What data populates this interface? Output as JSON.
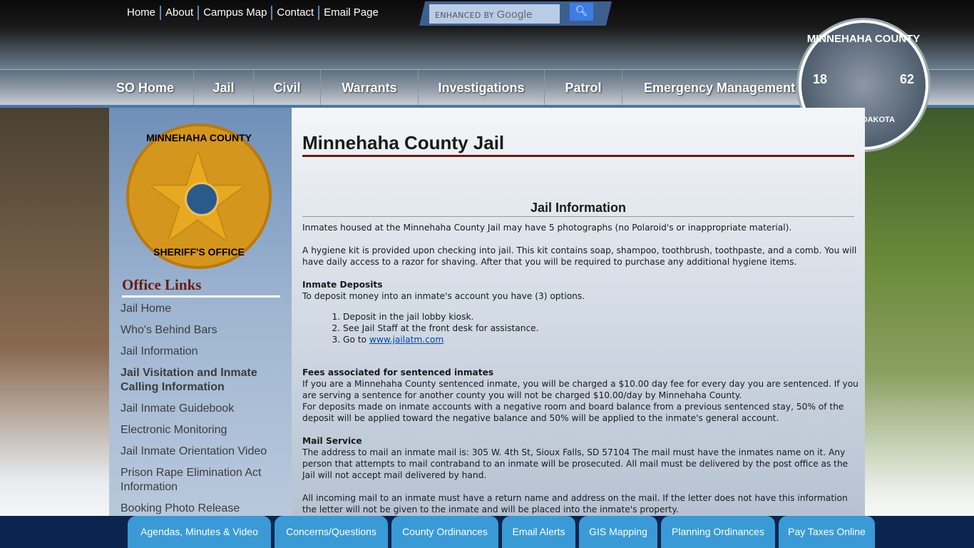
{
  "utility_nav": [
    "Home",
    "About",
    "Campus Map",
    "Contact",
    "Email Page"
  ],
  "search": {
    "placeholder_prefix": "ENHANCED BY",
    "placeholder_brand": "Google",
    "button_icon": "search-icon"
  },
  "main_nav": [
    "SO Home",
    "Jail",
    "Civil",
    "Warrants",
    "Investigations",
    "Patrol",
    "Emergency Management"
  ],
  "county_seal": {
    "top": "MINNEHAHA COUNTY",
    "year_left": "18",
    "year_right": "62",
    "bottom": "SOUTH DAKOTA"
  },
  "sheriff_badge": {
    "top": "MINNEHAHA COUNTY",
    "bottom": "SHERIFF'S OFFICE"
  },
  "sidebar": {
    "heading": "Office Links",
    "links": [
      "Jail Home",
      "Who's Behind Bars",
      "Jail Information",
      "Jail Visitation and Inmate Calling Information",
      "Jail Inmate Guidebook",
      "Electronic Monitoring",
      "Jail Inmate Orientation Video",
      "Prison Rape Elimination Act Information",
      "Booking Photo Release"
    ]
  },
  "page": {
    "title": "Minnehaha County Jail",
    "section_title": "Jail Information",
    "p1": "Inmates housed at the Minnehaha County Jail may have 5 photographs (no Polaroid's or inappropriate material).",
    "p2": "A hygiene kit is provided upon checking into jail. This kit contains soap, shampoo, toothbrush, toothpaste, and a comb. You will have daily access to a razor for shaving. After that you will be required to purchase any additional hygiene items.",
    "deposits_heading": "Inmate Deposits",
    "deposits_intro": "To deposit money into an inmate's account you have (3) options.",
    "deposit_options": [
      "Deposit in the jail lobby kiosk.",
      "See Jail Staff at the front desk for assistance.",
      "Go to "
    ],
    "deposit_link": "www.jailatm.com",
    "fees_heading": "Fees associated for sentenced inmates",
    "fees_p1": "If you are a Minnehaha County sentenced inmate, you will be charged a $10.00 day fee for every day you are sentenced. If you are serving a sentence for another county you will not be charged $10.00/day by Minnehaha County.",
    "fees_p2": "For deposits made on inmate accounts with a negative room and board balance from a previous sentenced stay, 50% of the deposit will be applied toward the negative balance and 50% will be applied to the inmate's general account.",
    "mail_heading": "Mail Service",
    "mail_p1": "The address to mail an inmate mail is: 305 W. 4th St, Sioux Falls, SD 57104 The mail must have the inmates name on it. Any person that attempts to mail contraband to an inmate will be prosecuted. All mail must be delivered by the post office as the Jail will not accept mail delivered by hand.",
    "mail_p2": "All incoming mail to an inmate must have a return name and address on the mail. If the letter does not have this information the letter will not be given to the inmate and will be placed into the inmate's property."
  },
  "footer_links": [
    "Agendas, Minutes & Video",
    "Concerns/Questions",
    "County Ordinances",
    "Email Alerts",
    "GIS Mapping",
    "Planning Ordinances",
    "Pay Taxes Online"
  ]
}
